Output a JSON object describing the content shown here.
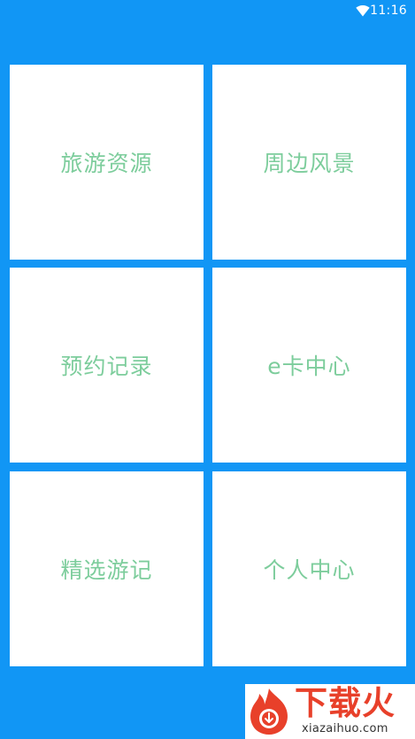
{
  "status_bar": {
    "time": "11:16",
    "wifi_icon": "wifi-icon"
  },
  "menu": {
    "tiles": [
      {
        "label": "旅游资源"
      },
      {
        "label": "周边风景"
      },
      {
        "label": "预约记录"
      },
      {
        "label": "e卡中心"
      },
      {
        "label": "精选游记"
      },
      {
        "label": "个人中心"
      }
    ]
  },
  "watermark": {
    "title": "下载火",
    "subtitle": "xiazaihuo.com"
  },
  "colors": {
    "background": "#1196f5",
    "tile": "#ffffff",
    "label": "#7dcd9c",
    "brand": "#e8402a"
  }
}
